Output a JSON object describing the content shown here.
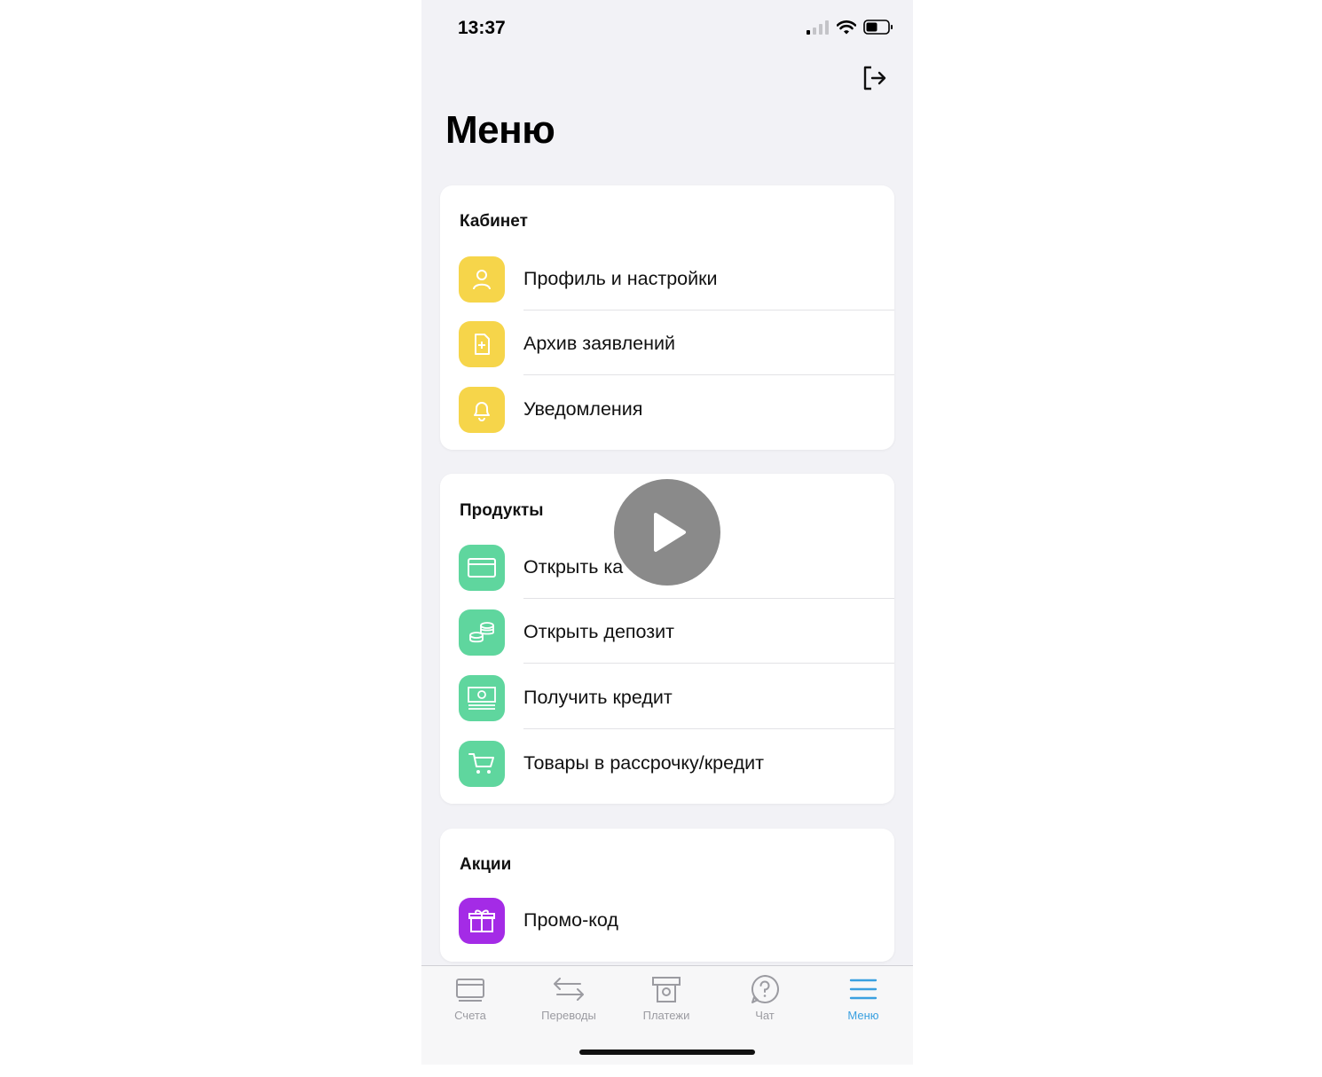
{
  "status": {
    "time": "13:37"
  },
  "page_title": "Меню",
  "sections": [
    {
      "title": "Кабинет",
      "items": [
        {
          "label": "Профиль и настройки",
          "icon": "person-icon",
          "color": "#f6d54a"
        },
        {
          "label": "Архив заявлений",
          "icon": "document-icon",
          "color": "#f6d54a"
        },
        {
          "label": "Уведомления",
          "icon": "bell-icon",
          "color": "#f6d54a"
        }
      ]
    },
    {
      "title": "Продукты",
      "items": [
        {
          "label": "Открыть ка",
          "icon": "card-icon",
          "color": "#5fd69e"
        },
        {
          "label": "Открыть депозит",
          "icon": "coins-icon",
          "color": "#5fd69e"
        },
        {
          "label": "Получить кредит",
          "icon": "banknote-icon",
          "color": "#5fd69e"
        },
        {
          "label": "Товары в рассрочку/кредит",
          "icon": "cart-icon",
          "color": "#5fd69e"
        }
      ]
    },
    {
      "title": "Акции",
      "items": [
        {
          "label": "Промо-код",
          "icon": "gift-icon",
          "color": "#a42be6"
        }
      ]
    }
  ],
  "tabs": [
    {
      "label": "Счета",
      "icon": "accounts-icon",
      "active": false
    },
    {
      "label": "Переводы",
      "icon": "transfer-arrows-icon",
      "active": false
    },
    {
      "label": "Платежи",
      "icon": "payments-icon",
      "active": false
    },
    {
      "label": "Чат",
      "icon": "chat-question-icon",
      "active": false
    },
    {
      "label": "Меню",
      "icon": "menu-icon",
      "active": true
    }
  ],
  "colors": {
    "accent": "#3aa0e0",
    "background": "#f2f2f6"
  }
}
